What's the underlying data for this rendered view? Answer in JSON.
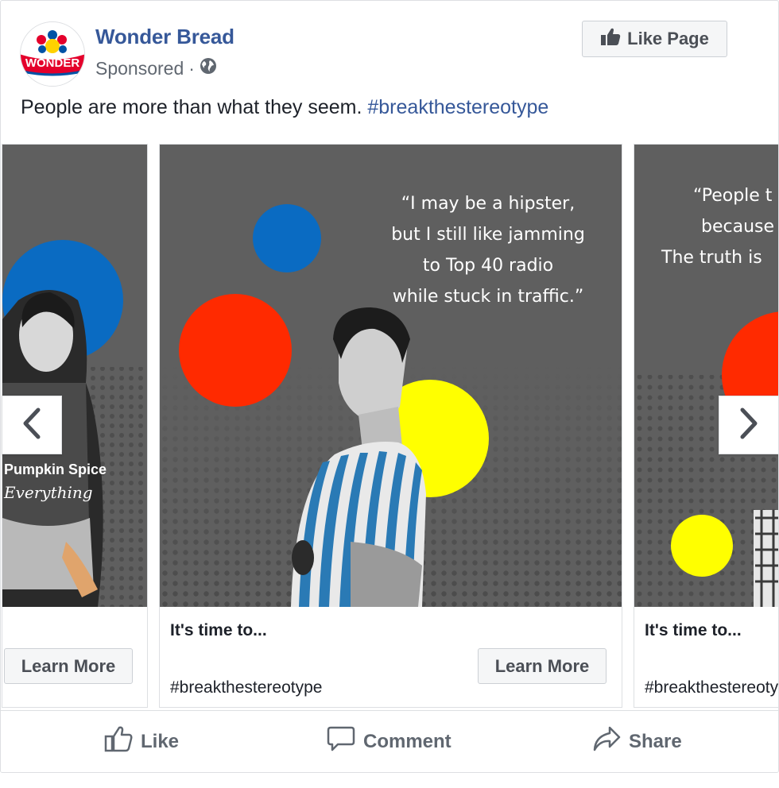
{
  "page": {
    "name": "Wonder Bread",
    "sponsored_label": "Sponsored",
    "separator": "·",
    "logo_text": "WONDER"
  },
  "like_page_button": {
    "label": "Like Page"
  },
  "post": {
    "text": "People are more than what they seem.",
    "hashtag": "#breakthestereotype"
  },
  "carousel": {
    "cards": [
      {
        "image_text": [
          "Pumpkin Spice",
          "Everything"
        ],
        "cta_label": "Learn More"
      },
      {
        "quote_lines": [
          "“I may be a hipster,",
          "but I still like jamming",
          "to Top 40 radio",
          "while stuck in traffic.”"
        ],
        "headline": "It's time to...",
        "cta_label": "Learn More",
        "link_text": "#breakthestereotype"
      },
      {
        "quote_lines": [
          "“People t",
          "because",
          "The truth is"
        ],
        "headline": "It's time to...",
        "link_text": "#breakthestereoty"
      }
    ],
    "prev_icon": "chevron-left-icon",
    "next_icon": "chevron-right-icon"
  },
  "actions": {
    "like": "Like",
    "comment": "Comment",
    "share": "Share"
  },
  "colors": {
    "brand_blue": "#365899",
    "circle_blue": "#0a6bc2",
    "circle_red": "#ff2a00",
    "circle_yellow": "#ffff00",
    "card_background": "#5f5f5f"
  }
}
